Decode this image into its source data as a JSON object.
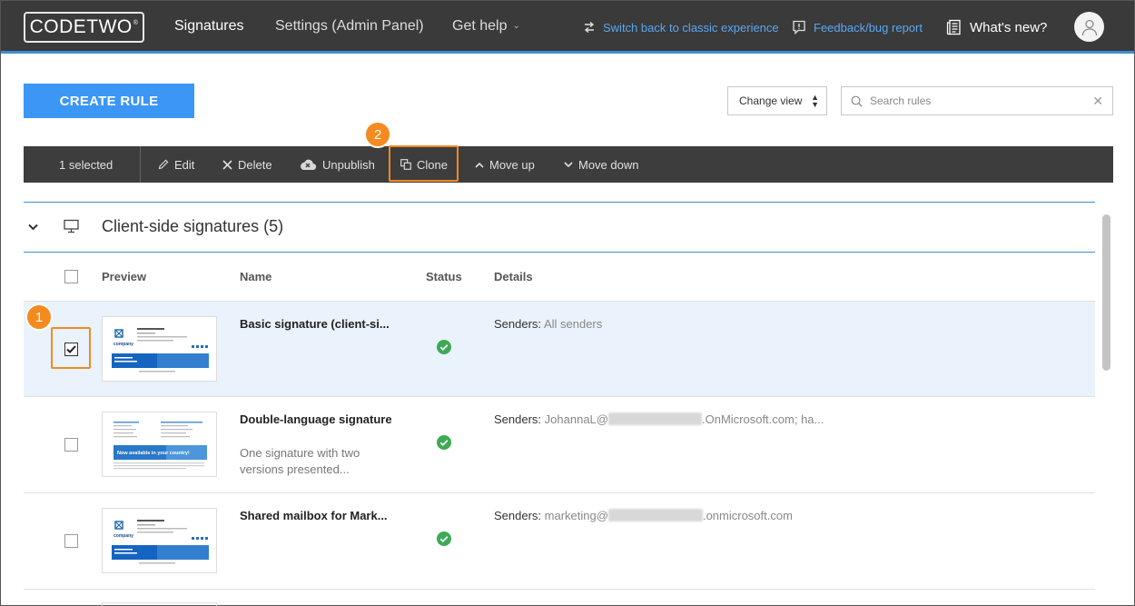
{
  "brand": {
    "logo_text": "CODETWO",
    "logo_mark": "®"
  },
  "nav": {
    "tabs": [
      {
        "label": "Signatures"
      },
      {
        "label": "Settings (Admin Panel)"
      },
      {
        "label": "Get help"
      }
    ],
    "classic_link": "Switch back to classic experience",
    "feedback_link": "Feedback/bug report",
    "whats_new": "What's new?"
  },
  "toolbar": {
    "create_rule": "CREATE RULE",
    "change_view": "Change view",
    "search_placeholder": "Search rules"
  },
  "actionbar": {
    "selected": "1 selected",
    "edit": "Edit",
    "delete": "Delete",
    "unpublish": "Unpublish",
    "clone": "Clone",
    "move_up": "Move up",
    "move_down": "Move down"
  },
  "callouts": {
    "one": "1",
    "two": "2"
  },
  "group": {
    "title": "Client-side signatures (5)"
  },
  "columns": {
    "preview": "Preview",
    "name": "Name",
    "status": "Status",
    "details": "Details"
  },
  "rows": [
    {
      "name": "Basic signature (client-si...",
      "description": "",
      "details_label": "Senders:",
      "details_value": "All senders",
      "checked": true
    },
    {
      "name": "Double-language signature",
      "description": "One signature with two versions presented...",
      "details_label": "Senders:",
      "details_value_prefix": "JohannaL@",
      "details_value_suffix": ".OnMicrosoft.com; ha...",
      "checked": false
    },
    {
      "name": "Shared mailbox for Mark...",
      "description": "",
      "details_label": "Senders:",
      "details_value_prefix": "marketing@",
      "details_value_suffix": ".onmicrosoft.com",
      "checked": false
    }
  ],
  "thumbnail": {
    "company": "company",
    "banner": "Now available in your country!"
  },
  "colors": {
    "accent": "#3e8ed0",
    "callout": "#f58a1f",
    "status_ok": "#3daa55",
    "button": "#3b96f5"
  }
}
